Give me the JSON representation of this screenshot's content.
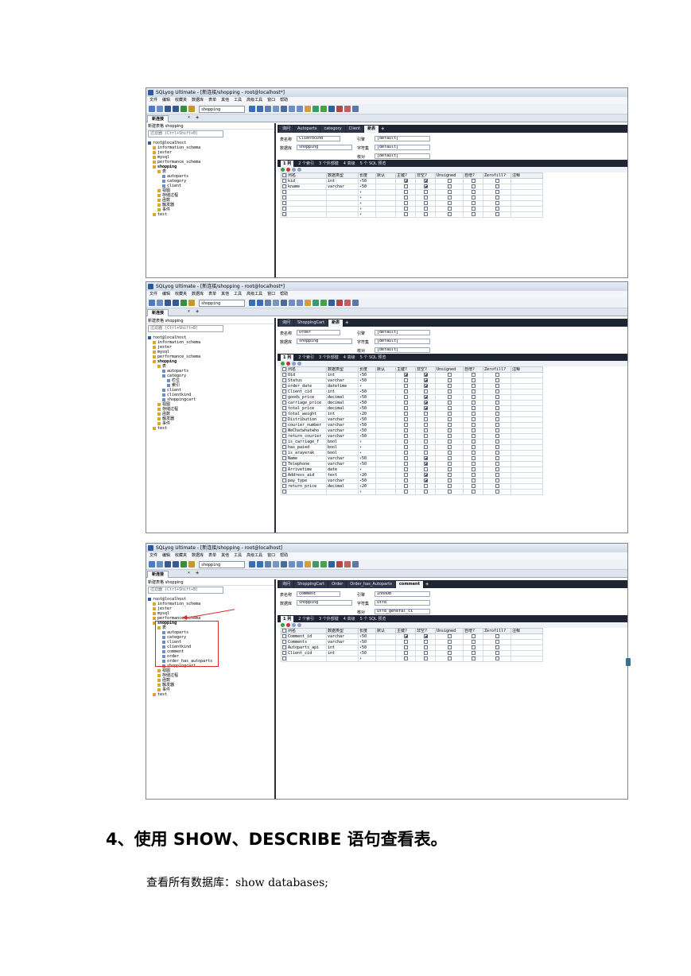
{
  "shots": [
    {
      "title": "SQLyog Ultimate - [新连接/shopping - root@localhost*]",
      "menu": [
        "文件",
        "编辑",
        "收藏夹",
        "数据库",
        "表单",
        "其他",
        "工具",
        "高级工具",
        "窗口",
        "帮助"
      ],
      "db_selector": "shopping",
      "conn_tab": "新连接",
      "left_header": "新建表格 shopping",
      "filter_placeholder": "过滤器 (Ctrl+Shift+B)",
      "tree": [
        {
          "text": "root@localhost",
          "indent": 0,
          "bold": false
        },
        {
          "text": "information_schema",
          "indent": 1,
          "bold": false
        },
        {
          "text": "jester",
          "indent": 1,
          "bold": false
        },
        {
          "text": "mysql",
          "indent": 1,
          "bold": false
        },
        {
          "text": "performance_schema",
          "indent": 1,
          "bold": false
        },
        {
          "text": "shopping",
          "indent": 1,
          "bold": true
        },
        {
          "text": "表",
          "indent": 2,
          "bold": false
        },
        {
          "text": "autoparts",
          "indent": 3,
          "bold": false
        },
        {
          "text": "category",
          "indent": 3,
          "bold": false
        },
        {
          "text": "client",
          "indent": 3,
          "bold": false
        },
        {
          "text": "视图",
          "indent": 2,
          "bold": false
        },
        {
          "text": "存储过程",
          "indent": 2,
          "bold": false
        },
        {
          "text": "函数",
          "indent": 2,
          "bold": false
        },
        {
          "text": "触发器",
          "indent": 2,
          "bold": false
        },
        {
          "text": "事件",
          "indent": 2,
          "bold": false
        },
        {
          "text": "test",
          "indent": 1,
          "bold": false
        }
      ],
      "query_tabs": [
        {
          "label": "询问",
          "active": false
        },
        {
          "label": "Autoparts",
          "active": false
        },
        {
          "label": "category",
          "active": false
        },
        {
          "label": "Client",
          "active": false
        },
        {
          "label": "新表",
          "active": true
        }
      ],
      "props": {
        "table_name_label": "表名称",
        "table_name": "Clientkind",
        "engine_label": "引擎",
        "engine": "[default]",
        "database_label": "数据库",
        "database": "shopping",
        "charset_label": "字符集",
        "charset": "[default]",
        "collation_label": "核对",
        "collation": "[default]"
      },
      "subtabs": [
        "1 列",
        "2 个索引",
        "3 个外部键",
        "4 高级",
        "5 个 SQL 预览"
      ],
      "columns_header": [
        "列名",
        "数据类型",
        "长度",
        "默认",
        "主键?",
        "非空?",
        "Unsigned",
        "自增?",
        "Zerofill?",
        "注释"
      ],
      "rows": [
        {
          "name": "kid",
          "type": "int",
          "len": "50",
          "pk": true,
          "nn": true
        },
        {
          "name": "kname",
          "type": "varchar",
          "len": "50",
          "pk": false,
          "nn": true
        },
        {
          "name": "",
          "type": "",
          "len": "",
          "pk": false,
          "nn": false
        },
        {
          "name": "",
          "type": "",
          "len": "",
          "pk": false,
          "nn": false
        },
        {
          "name": "",
          "type": "",
          "len": "",
          "pk": false,
          "nn": false
        },
        {
          "name": "",
          "type": "",
          "len": "",
          "pk": false,
          "nn": false
        },
        {
          "name": "",
          "type": "",
          "len": "",
          "pk": false,
          "nn": false
        }
      ]
    },
    {
      "title": "SQLyog Ultimate - [新连接/shopping - root@localhost*]",
      "menu": [
        "文件",
        "编辑",
        "收藏夹",
        "数据库",
        "表单",
        "其他",
        "工具",
        "高级工具",
        "窗口",
        "帮助"
      ],
      "db_selector": "shopping",
      "conn_tab": "新连接",
      "left_header": "新建表格 shopping",
      "filter_placeholder": "过滤器 (Ctrl+Shift+B)",
      "tree": [
        {
          "text": "root@localhost",
          "indent": 0,
          "bold": false
        },
        {
          "text": "information_schema",
          "indent": 1,
          "bold": false
        },
        {
          "text": "jester",
          "indent": 1,
          "bold": false
        },
        {
          "text": "mysql",
          "indent": 1,
          "bold": false
        },
        {
          "text": "performance_schema",
          "indent": 1,
          "bold": false
        },
        {
          "text": "shopping",
          "indent": 1,
          "bold": true
        },
        {
          "text": "表",
          "indent": 2,
          "bold": false
        },
        {
          "text": "autoparts",
          "indent": 3,
          "bold": false
        },
        {
          "text": "category",
          "indent": 3,
          "bold": false
        },
        {
          "text": "栏位",
          "indent": 4,
          "bold": false
        },
        {
          "text": "索引",
          "indent": 4,
          "bold": false
        },
        {
          "text": "client",
          "indent": 3,
          "bold": false
        },
        {
          "text": "clientkind",
          "indent": 3,
          "bold": false
        },
        {
          "text": "shoppingcart",
          "indent": 3,
          "bold": false
        },
        {
          "text": "视图",
          "indent": 2,
          "bold": false
        },
        {
          "text": "存储过程",
          "indent": 2,
          "bold": false
        },
        {
          "text": "函数",
          "indent": 2,
          "bold": false
        },
        {
          "text": "触发器",
          "indent": 2,
          "bold": false
        },
        {
          "text": "事件",
          "indent": 2,
          "bold": false
        },
        {
          "text": "test",
          "indent": 1,
          "bold": false
        }
      ],
      "query_tabs": [
        {
          "label": "询问",
          "active": false
        },
        {
          "label": "ShoppingCart",
          "active": false
        },
        {
          "label": "新表",
          "active": true
        }
      ],
      "props": {
        "table_name_label": "表名称",
        "table_name": "Order",
        "engine_label": "引擎",
        "engine": "[default]",
        "database_label": "数据库",
        "database": "shopping",
        "charset_label": "字符集",
        "charset": "[default]",
        "collation_label": "核对",
        "collation": "[default]"
      },
      "subtabs": [
        "1 列",
        "2 个索引",
        "3 个外部键",
        "4 高级",
        "5 个 SQL 预览"
      ],
      "columns_header": [
        "列名",
        "数据类型",
        "长度",
        "默认",
        "主键?",
        "非空?",
        "Unsigned",
        "自增?",
        "Zerofill?",
        "注释"
      ],
      "rows": [
        {
          "name": "Oid",
          "type": "int",
          "len": "50",
          "pk": true,
          "nn": true
        },
        {
          "name": "Status",
          "type": "varchar",
          "len": "50",
          "pk": false,
          "nn": true
        },
        {
          "name": "order_date",
          "type": "datetime",
          "len": "",
          "pk": false,
          "nn": true
        },
        {
          "name": "Client_cid",
          "type": "int",
          "len": "50",
          "pk": false,
          "nn": false
        },
        {
          "name": "goods_price",
          "type": "decimal",
          "len": "50",
          "pk": false,
          "nn": true
        },
        {
          "name": "carriage_price",
          "type": "decimal",
          "len": "50",
          "pk": false,
          "nn": true
        },
        {
          "name": "total_price",
          "type": "decimal",
          "len": "50",
          "pk": false,
          "nn": true
        },
        {
          "name": "total_weight",
          "type": "int",
          "len": "20",
          "pk": false,
          "nn": false
        },
        {
          "name": "Distribution",
          "type": "varchar",
          "len": "50",
          "pk": false,
          "nn": false
        },
        {
          "name": "courier_number",
          "type": "varchar",
          "len": "50",
          "pk": false,
          "nn": false
        },
        {
          "name": "WeChatwhatwho",
          "type": "varchar",
          "len": "50",
          "pk": false,
          "nn": false
        },
        {
          "name": "return_courier",
          "type": "varchar",
          "len": "50",
          "pk": false,
          "nn": false
        },
        {
          "name": "is_carriage_f",
          "type": "bool",
          "len": "",
          "pk": false,
          "nn": false
        },
        {
          "name": "has_paied",
          "type": "bool",
          "len": "",
          "pk": false,
          "nn": false
        },
        {
          "name": "is_arayerak",
          "type": "bool",
          "len": "",
          "pk": false,
          "nn": false
        },
        {
          "name": "Name",
          "type": "varchar",
          "len": "50",
          "pk": false,
          "nn": true
        },
        {
          "name": "Telephone",
          "type": "varchar",
          "len": "50",
          "pk": false,
          "nn": true
        },
        {
          "name": "Arrivetime",
          "type": "date",
          "len": "",
          "pk": false,
          "nn": false
        },
        {
          "name": "Address_aid",
          "type": "text",
          "len": "20",
          "pk": false,
          "nn": true
        },
        {
          "name": "pay_type",
          "type": "varchar",
          "len": "50",
          "pk": false,
          "nn": true
        },
        {
          "name": "return_price",
          "type": "decimal",
          "len": "20",
          "pk": false,
          "nn": false
        },
        {
          "name": "",
          "type": "",
          "len": "",
          "pk": false,
          "nn": false
        }
      ]
    },
    {
      "title": "SQLyog Ultimate - [新连接/shopping - root@localhost]",
      "menu": [
        "文件",
        "编辑",
        "收藏夹",
        "数据库",
        "表单",
        "其他",
        "工具",
        "高级工具",
        "窗口",
        "帮助"
      ],
      "db_selector": "shopping",
      "conn_tab": "新连接",
      "left_header": "新建表格 shopping",
      "filter_placeholder": "过滤器 (Ctrl+Shift+B)",
      "tree": [
        {
          "text": "root@localhost",
          "indent": 0,
          "bold": false
        },
        {
          "text": "information_schema",
          "indent": 1,
          "bold": false
        },
        {
          "text": "jester",
          "indent": 1,
          "bold": false
        },
        {
          "text": "mysql",
          "indent": 1,
          "bold": false
        },
        {
          "text": "performance_schema",
          "indent": 1,
          "bold": false
        },
        {
          "text": "shopping",
          "indent": 1,
          "bold": true
        },
        {
          "text": "表",
          "indent": 2,
          "bold": false
        },
        {
          "text": "autoparts",
          "indent": 3,
          "bold": false
        },
        {
          "text": "category",
          "indent": 3,
          "bold": false
        },
        {
          "text": "client",
          "indent": 3,
          "bold": false
        },
        {
          "text": "clientkind",
          "indent": 3,
          "bold": false
        },
        {
          "text": "comment",
          "indent": 3,
          "bold": false
        },
        {
          "text": "order",
          "indent": 3,
          "bold": false
        },
        {
          "text": "order_has_autoparts",
          "indent": 3,
          "bold": false
        },
        {
          "text": "shoppingcart",
          "indent": 3,
          "bold": false
        },
        {
          "text": "视图",
          "indent": 2,
          "bold": false
        },
        {
          "text": "存储过程",
          "indent": 2,
          "bold": false
        },
        {
          "text": "函数",
          "indent": 2,
          "bold": false
        },
        {
          "text": "触发器",
          "indent": 2,
          "bold": false
        },
        {
          "text": "事件",
          "indent": 2,
          "bold": false
        },
        {
          "text": "test",
          "indent": 1,
          "bold": false
        }
      ],
      "query_tabs": [
        {
          "label": "询问",
          "active": false
        },
        {
          "label": "ShoppingCart",
          "active": false
        },
        {
          "label": "Order",
          "active": false
        },
        {
          "label": "Order_has_Autoparts",
          "active": false
        },
        {
          "label": "comment",
          "active": true
        }
      ],
      "props": {
        "table_name_label": "表名称",
        "table_name": "comment",
        "engine_label": "引擎",
        "engine": "InnoDB",
        "database_label": "数据库",
        "database": "shopping",
        "charset_label": "字符集",
        "charset": "utf8",
        "collation_label": "核对",
        "collation": "utf8_general_ci"
      },
      "subtabs": [
        "1 列",
        "2 个索引",
        "3 个外部键",
        "4 高级",
        "5 个 SQL 预览"
      ],
      "columns_header": [
        "列名",
        "数据类型",
        "长度",
        "默认",
        "主键?",
        "非空?",
        "Unsigned",
        "自增?",
        "Zerofill?",
        "注释"
      ],
      "rows": [
        {
          "name": "Comment_id",
          "type": "varchar",
          "len": "50",
          "pk": true,
          "nn": true
        },
        {
          "name": "Comments",
          "type": "varchar",
          "len": "50",
          "pk": false,
          "nn": false
        },
        {
          "name": "Autoparts_api",
          "type": "int",
          "len": "50",
          "pk": false,
          "nn": false
        },
        {
          "name": "Client_cid",
          "type": "int",
          "len": "50",
          "pk": false,
          "nn": false
        },
        {
          "name": "",
          "type": "",
          "len": "",
          "pk": false,
          "nn": false
        }
      ]
    }
  ],
  "heading": "4、使用 SHOW、DESCRIBE 语句查看表。",
  "paragraph": "查看所有数据库：show databases;",
  "colors": {
    "dark_tab_bar": "#1f2433",
    "accent_blue": "#2b5aa0",
    "annotation_red": "#d92b2b"
  }
}
